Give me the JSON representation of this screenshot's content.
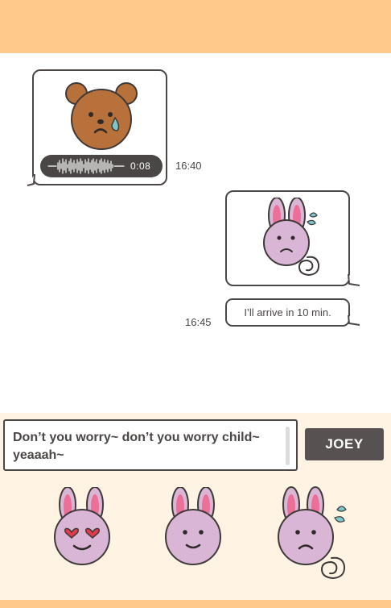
{
  "colors": {
    "header": "#ffc98c",
    "composer_bg": "#fff3e4",
    "outline": "#4b4745",
    "bear_fur": "#b8713a",
    "bunny_fur": "#d9b6d6",
    "bunny_ear_inner": "#ec6f97",
    "tear": "#7cc6cc"
  },
  "messages": [
    {
      "side": "left",
      "sticker": "sad-bear",
      "voice_duration": "0:08",
      "time": "16:40"
    },
    {
      "side": "right",
      "sticker": "worried-bunny"
    },
    {
      "side": "right",
      "text": "I’ll arrive in 10 min.",
      "time": "16:45"
    }
  ],
  "composer": {
    "input_value": "Don’t you worry~ don’t you worry child~ yeaaah~",
    "send_label": "JOEY"
  },
  "sticker_picker": [
    {
      "name": "heart-eyes-bunny"
    },
    {
      "name": "smiling-bunny"
    },
    {
      "name": "worried-bunny"
    }
  ]
}
